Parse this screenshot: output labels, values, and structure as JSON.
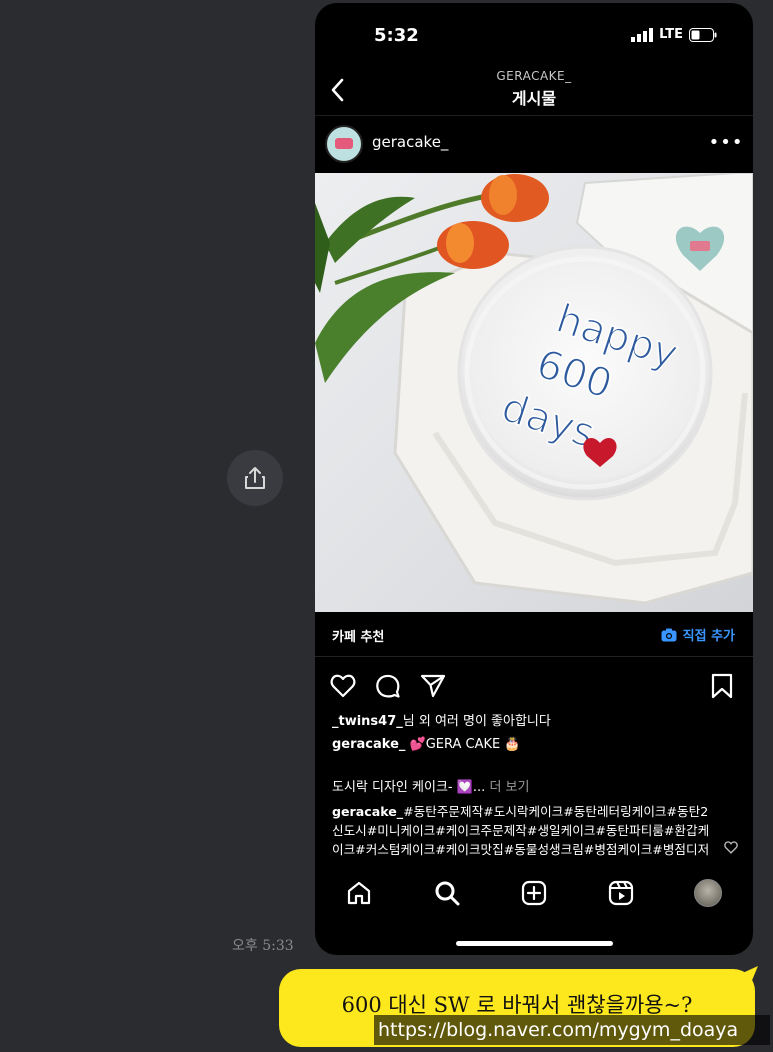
{
  "status_bar": {
    "time": "5:32",
    "network": "LTE"
  },
  "header": {
    "subtitle": "GERACAKE_",
    "title": "게시물"
  },
  "post": {
    "username": "geracake_",
    "cake_text": [
      "happy",
      "600",
      "days"
    ]
  },
  "cafe_bar": {
    "label": "카페 추천",
    "add_label": "직접 추가"
  },
  "likes": {
    "user": "_twins47_",
    "rest": "님 외 여러 명이 좋아합니다"
  },
  "caption": {
    "user": "geracake_",
    "title": "💕GERA CAKE 🎂",
    "line2": "도시락 디자인 케이크- 💟...",
    "more": " 더 보기",
    "hashtags": "#동탄주문제작#도시락케이크#동탄레터링케이크#동탄2신도시#미니케이크#케이크주문제작#생일케이크#동탄파티룸#환갑케이크#커스텀케이크#케이크맛집#동물성생크림#병점케이크#병점디저트#동탄부각장#동탄스타주후"
  },
  "tabs": [
    "home",
    "search",
    "create",
    "reels",
    "profile"
  ],
  "chat": {
    "timestamp": "오후 5:33",
    "message": "600 대신 SW 로 바꿔서 괜찮을까용~?"
  },
  "watermark": "https://blog.naver.com/mygym_doaya",
  "colors": {
    "bubble": "#fde81e",
    "accent_blue": "#3a96ff",
    "background": "#2b2c30"
  }
}
